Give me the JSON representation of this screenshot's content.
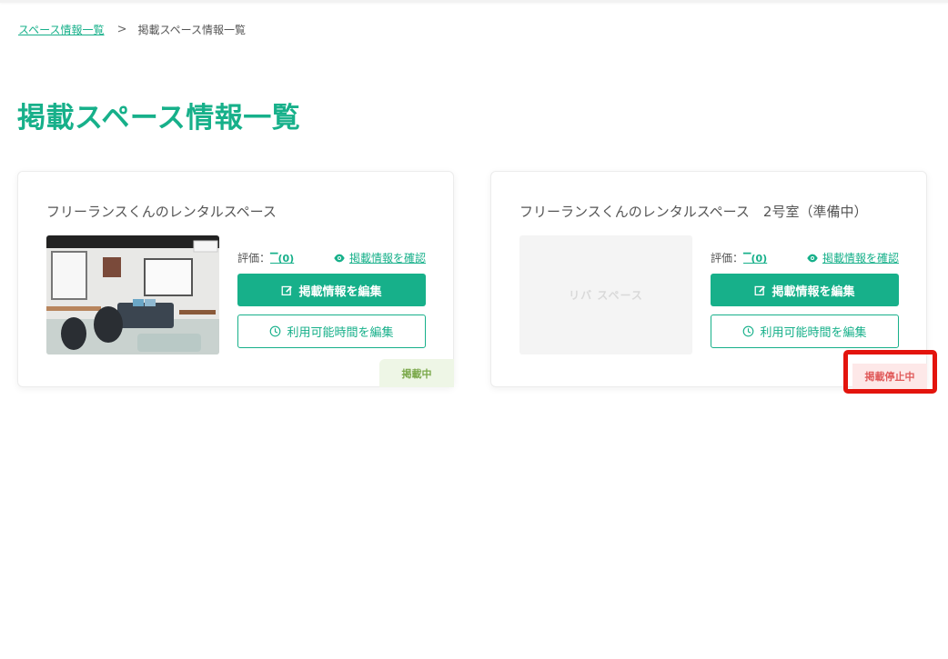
{
  "breadcrumb": {
    "parent": "スペース情報一覧",
    "separator": ">",
    "current": "掲載スペース情報一覧"
  },
  "page_title": "掲載スペース情報一覧",
  "cards": [
    {
      "title": "フリーランスくんのレンタルスペース",
      "rating_label": "評価：",
      "rating_value": "(0)",
      "view_link": "掲載情報を確認",
      "edit_button": "掲載情報を編集",
      "time_button": "利用可能時間を編集",
      "status": "掲載中"
    },
    {
      "title": "フリーランスくんのレンタルスペース　2号室（準備中）",
      "rating_label": "評価：",
      "rating_value": "(0)",
      "view_link": "掲載情報を確認",
      "edit_button": "掲載情報を編集",
      "time_button": "利用可能時間を編集",
      "status": "掲載停止中",
      "placeholder_logo": "リバ スペース"
    }
  ],
  "colors": {
    "accent": "#17b08a",
    "status_active_bg": "#eef6e6",
    "status_stopped_bg": "#fde8e8",
    "highlight": "#e3140d"
  }
}
